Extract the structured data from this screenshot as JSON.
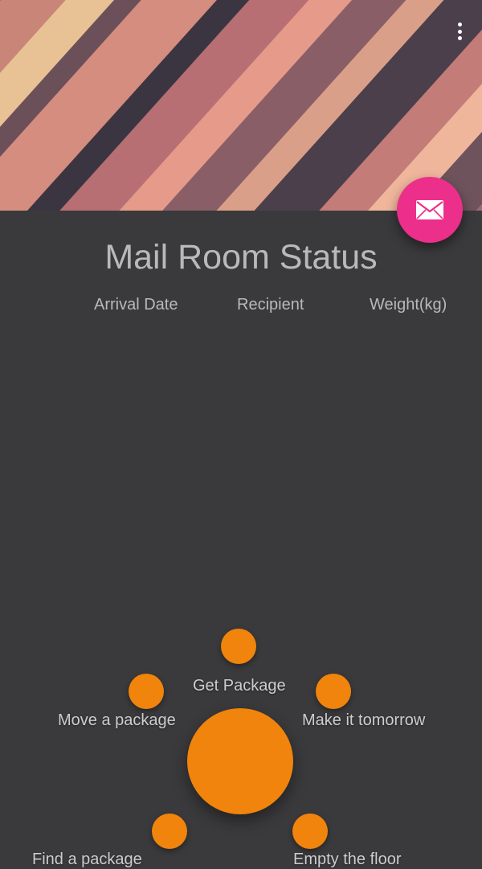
{
  "header": {
    "title": "Mail Room Status"
  },
  "table": {
    "columns": [
      "Arrival Date",
      "Recipient",
      "Weight(kg)"
    ]
  },
  "actions": {
    "items": [
      {
        "label": "Get Package"
      },
      {
        "label": "Move a package"
      },
      {
        "label": "Make it tomorrow"
      },
      {
        "label": "Find a package"
      },
      {
        "label": "Empty the floor"
      }
    ]
  },
  "colors": {
    "fab": "#ec2f8a",
    "accent": "#f0840c",
    "background": "#3a393b"
  },
  "icons": {
    "fab": "mail-icon",
    "menu": "more-vert-icon"
  }
}
